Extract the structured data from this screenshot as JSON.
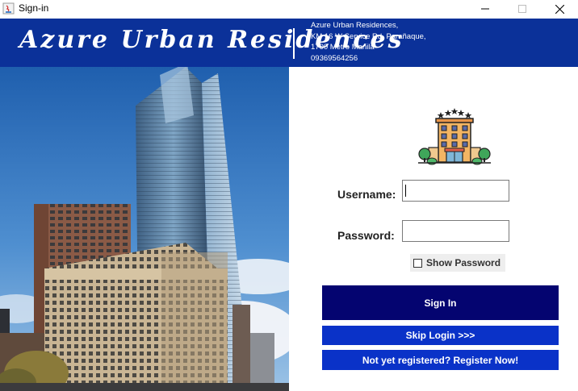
{
  "window": {
    "title": "Sign-in",
    "icons": [
      "java-app-icon",
      "minimize-icon",
      "maximize-icon",
      "close-icon"
    ]
  },
  "header": {
    "brand": "Azure Urban Residences",
    "address_lines": [
      "Azure Urban Residences,",
      "KM 16 W Service Rd, Parañaque,",
      "1700 Metro Manila",
      "09369564256"
    ],
    "background": "#0b3199"
  },
  "photo": {
    "subject": "high-rise residential towers"
  },
  "login": {
    "logo_icon": "hotel-building-icon",
    "username_label": "Username:",
    "username_value": "",
    "password_label": "Password:",
    "password_value": "",
    "show_password_label": "Show Password",
    "show_password_checked": false,
    "signin_label": "Sign In",
    "skip_label": "Skip Login >>>",
    "register_label": "Not yet registered? Register Now!"
  },
  "colors": {
    "signin_button": "#040470",
    "secondary_buttons": "#0a32c8"
  }
}
